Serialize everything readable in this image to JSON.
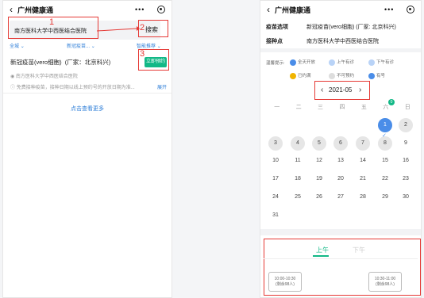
{
  "left": {
    "app_title": "广州健康通",
    "search_value": "南方医科大学中西医结合医院",
    "search_button": "搜索",
    "filters": [
      "全城",
      "新冠疫苗...",
      "智能推荐"
    ],
    "vaccine_name": "新冠疫苗(vero细胞)",
    "manufacturer": "(厂家：北京科兴)",
    "hospital": "南方医科大学中西医结合医院",
    "notice": "免费接种疫苗，接种日期以线上预约号的开放日期为准...",
    "expand": "展开",
    "book_button": "立即预约",
    "more_link": "点击查看更多",
    "annotations": [
      "1",
      "2",
      "3"
    ]
  },
  "right": {
    "app_title": "广州健康通",
    "vaccine_label": "疫苗选项",
    "vaccine_value": "新冠疫苗(vero细胞) (厂家: 北京科兴)",
    "site_label": "接种点",
    "site_value": "南方医科大学中西医结合医院",
    "legend_title": "温馨提示:",
    "legend": [
      {
        "label": "全天开放",
        "color": "#4a8de8"
      },
      {
        "label": "上午有诊",
        "color": "#4a8de8"
      },
      {
        "label": "下午有诊",
        "color": "#4a8de8"
      },
      {
        "label": "已约满",
        "color": "#f0b400"
      },
      {
        "label": "不可预约",
        "color": "#dddddd"
      },
      {
        "label": "有号",
        "color": "#4a8de8"
      }
    ],
    "month": "2021-05",
    "weekdays": [
      "一",
      "二",
      "三",
      "四",
      "五",
      "六",
      "日"
    ],
    "badge_count": "0",
    "tabs": [
      "上午",
      "下午"
    ],
    "slots": [
      {
        "time": "10:00-10:30",
        "remain": "(剩余98人)"
      },
      {
        "time": "10:30-11:00",
        "remain": "(剩余98人)"
      }
    ]
  }
}
